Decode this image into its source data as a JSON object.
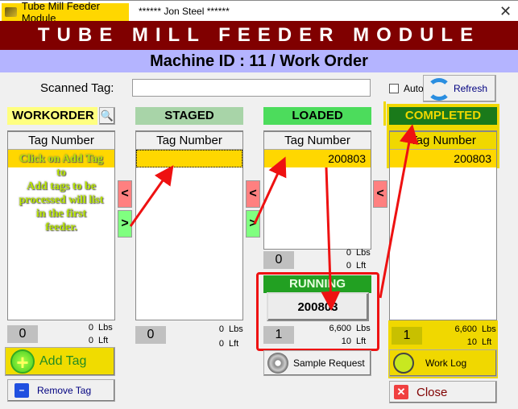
{
  "window": {
    "app_tab": "Tube Mill Feeder Module",
    "user": "****** Jon Steel ******",
    "close_glyph": "✕"
  },
  "header": {
    "title": "TUBE MILL FEEDER MODULE",
    "subtitle": "Machine ID : 11  /  Work Order"
  },
  "scan": {
    "label": "Scanned Tag:",
    "value": ""
  },
  "auto": {
    "label": "Auto",
    "checked": false
  },
  "refresh": {
    "label": "Refresh"
  },
  "workorder": {
    "title": "WORKORDER",
    "col": "Tag Number",
    "instructions": [
      "Click on Add Tag",
      "to",
      "Add tags to be",
      "processed will list",
      "in the first",
      "feeder."
    ],
    "count": "0",
    "lbs": "0",
    "lft": "0"
  },
  "staged": {
    "title": "STAGED",
    "col": "Tag Number",
    "rows": [
      ""
    ],
    "count": "0",
    "lbs": "0",
    "lft": "0"
  },
  "loaded": {
    "title": "LOADED",
    "col": "Tag Number",
    "rows": [
      "200803"
    ],
    "count": "0",
    "lbs": "0",
    "lft": "0"
  },
  "running": {
    "title": "RUNNING",
    "tag": "200803",
    "count": "1",
    "lbs": "6,600",
    "lft": "10"
  },
  "completed": {
    "title": "COMPLETED",
    "col": "Tag Number",
    "rows": [
      "200803"
    ],
    "count": "1",
    "lbs": "6,600",
    "lft": "10"
  },
  "units": {
    "lbs": "Lbs",
    "lft": "Lft"
  },
  "arrows": {
    "left": "<",
    "right": ">"
  },
  "buttons": {
    "add_tag": "Add Tag",
    "remove_tag": "Remove Tag",
    "sample_request": "Sample Request",
    "work_log": "Work Log",
    "close": "Close"
  },
  "colors": {
    "header_bg": "#800000",
    "subheader_bg": "#b4b4ff",
    "row_highlight": "#ffd700",
    "loaded": "#4cdc5c",
    "staged": "#a8d4a8",
    "completed": "#1a7a1a",
    "running": "#22a022",
    "annotation": "#ff0000"
  }
}
